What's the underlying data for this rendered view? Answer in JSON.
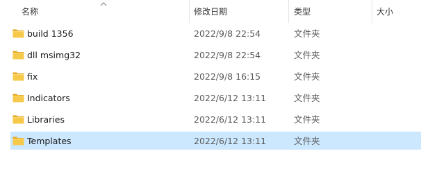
{
  "columns": {
    "name": "名称",
    "date": "修改日期",
    "type": "类型",
    "size": "大小"
  },
  "sort": {
    "column": "name",
    "direction": "ascending",
    "icon": "chevron-up-icon"
  },
  "folder_icon": "folder-icon",
  "colors": {
    "selection": "#cce8ff",
    "folder_body": "#f7c94a",
    "folder_tab": "#e5a823"
  },
  "rows": [
    {
      "name": "build 1356",
      "date": "2022/9/8 22:54",
      "type": "文件夹",
      "selected": false
    },
    {
      "name": "dll msimg32",
      "date": "2022/9/8 22:54",
      "type": "文件夹",
      "selected": false
    },
    {
      "name": "fix",
      "date": "2022/9/8 16:15",
      "type": "文件夹",
      "selected": false
    },
    {
      "name": "Indicators",
      "date": "2022/6/12 13:11",
      "type": "文件夹",
      "selected": false
    },
    {
      "name": "Libraries",
      "date": "2022/6/12 13:11",
      "type": "文件夹",
      "selected": false
    },
    {
      "name": "Templates",
      "date": "2022/6/12 13:11",
      "type": "文件夹",
      "selected": true
    }
  ]
}
